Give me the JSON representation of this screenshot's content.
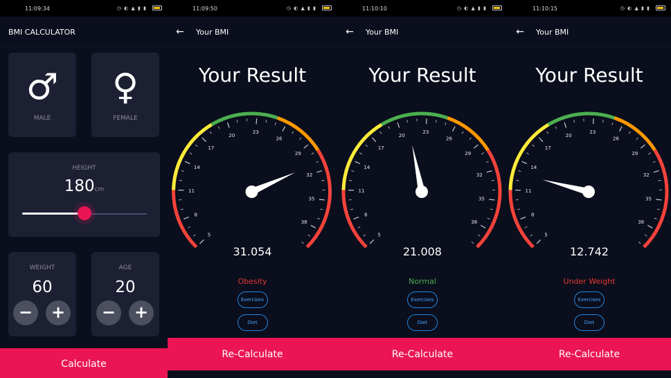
{
  "input_screen": {
    "status_time": "11:09:34",
    "title": "BMI CALCULATOR",
    "male": {
      "symbol": "♂",
      "label": "MALE"
    },
    "female": {
      "symbol": "♀",
      "label": "FEMALE"
    },
    "height": {
      "label": "HEIGHT",
      "value": "180",
      "unit": "cm",
      "slider_fraction": 0.5
    },
    "weight": {
      "label": "WEIGHT",
      "value": "60"
    },
    "age": {
      "label": "AGE",
      "value": "20"
    },
    "minus": "−",
    "plus": "+",
    "button": "Calculate"
  },
  "results": [
    {
      "status_time": "11:09:50",
      "title": "Your BMI",
      "heading": "Your Result",
      "bmi": "31.054",
      "bmi_num": 31.054,
      "category": "Obesity",
      "category_color": "#e53935",
      "exercises": "Exercises",
      "diet": "Diet",
      "button": "Re-Calculate"
    },
    {
      "status_time": "11:10:10",
      "title": "Your BMI",
      "heading": "Your Result",
      "bmi": "21.008",
      "bmi_num": 21.008,
      "category": "Normal",
      "category_color": "#4caf50",
      "exercises": "Exercises",
      "diet": "Diet",
      "button": "Re-Calculate"
    },
    {
      "status_time": "11:10:15",
      "title": "Your BMI",
      "heading": "Your Result",
      "bmi": "12.742",
      "bmi_num": 12.742,
      "category": "Under Weight",
      "category_color": "#e53935",
      "exercises": "Exercises",
      "diet": "Diet",
      "button": "Re-Calculate"
    }
  ],
  "gauge": {
    "min": 5,
    "max": 40,
    "ticks": [
      "5",
      "8",
      "11",
      "14",
      "17",
      "20",
      "23",
      "26",
      "29",
      "32",
      "35",
      "38"
    ],
    "tick_values": [
      5,
      8,
      11,
      14,
      17,
      20,
      23,
      26,
      29,
      32,
      35,
      38
    ],
    "bands": [
      {
        "from": 5,
        "to": 11,
        "color": "#f4433b"
      },
      {
        "from": 11,
        "to": 18.5,
        "color": "#ffeb3b"
      },
      {
        "from": 18.5,
        "to": 25,
        "color": "#4caf50"
      },
      {
        "from": 25,
        "to": 30,
        "color": "#ff9800"
      },
      {
        "from": 30,
        "to": 40,
        "color": "#f4433b"
      }
    ]
  }
}
